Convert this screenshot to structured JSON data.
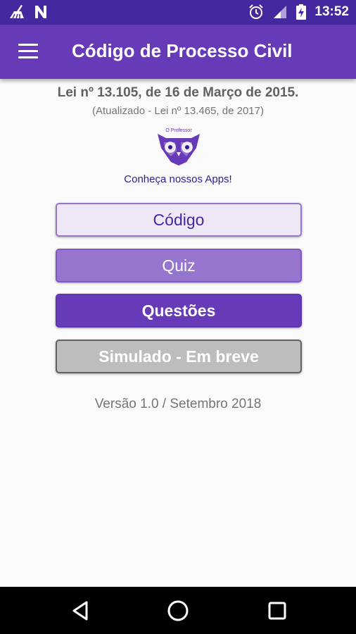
{
  "status_bar": {
    "time": "13:52",
    "left_icons": [
      "cleaner-icon",
      "n-notification-icon"
    ],
    "right_icons": [
      "alarm-icon",
      "signal-icon",
      "battery-charging-icon"
    ]
  },
  "app_bar": {
    "title": "Código de Processo Civil",
    "menu_icon": "hamburger-menu-icon"
  },
  "header": {
    "law_title": "Lei nº 13.105, de 16 de Março de 2015.",
    "law_subtitle": "(Atualizado - Lei nº 13.465, de 2017)"
  },
  "promo": {
    "logo_text": "O Professor",
    "caption": "Conheça nossos Apps!"
  },
  "buttons": {
    "codigo": "Código",
    "quiz": "Quiz",
    "questoes": "Questões",
    "simulado": "Simulado - Em breve"
  },
  "footer": {
    "version": "Versão 1.0 / Setembro 2018"
  },
  "colors": {
    "status_bar": "#4527a0",
    "app_bar": "#673ab7",
    "accent_light": "#ede7f6",
    "accent_mid": "#9575cd",
    "accent_dark": "#673ab7",
    "disabled": "#bdbdbd"
  },
  "nav_bar": {
    "icons": [
      "back-icon",
      "home-icon",
      "recents-icon"
    ]
  }
}
